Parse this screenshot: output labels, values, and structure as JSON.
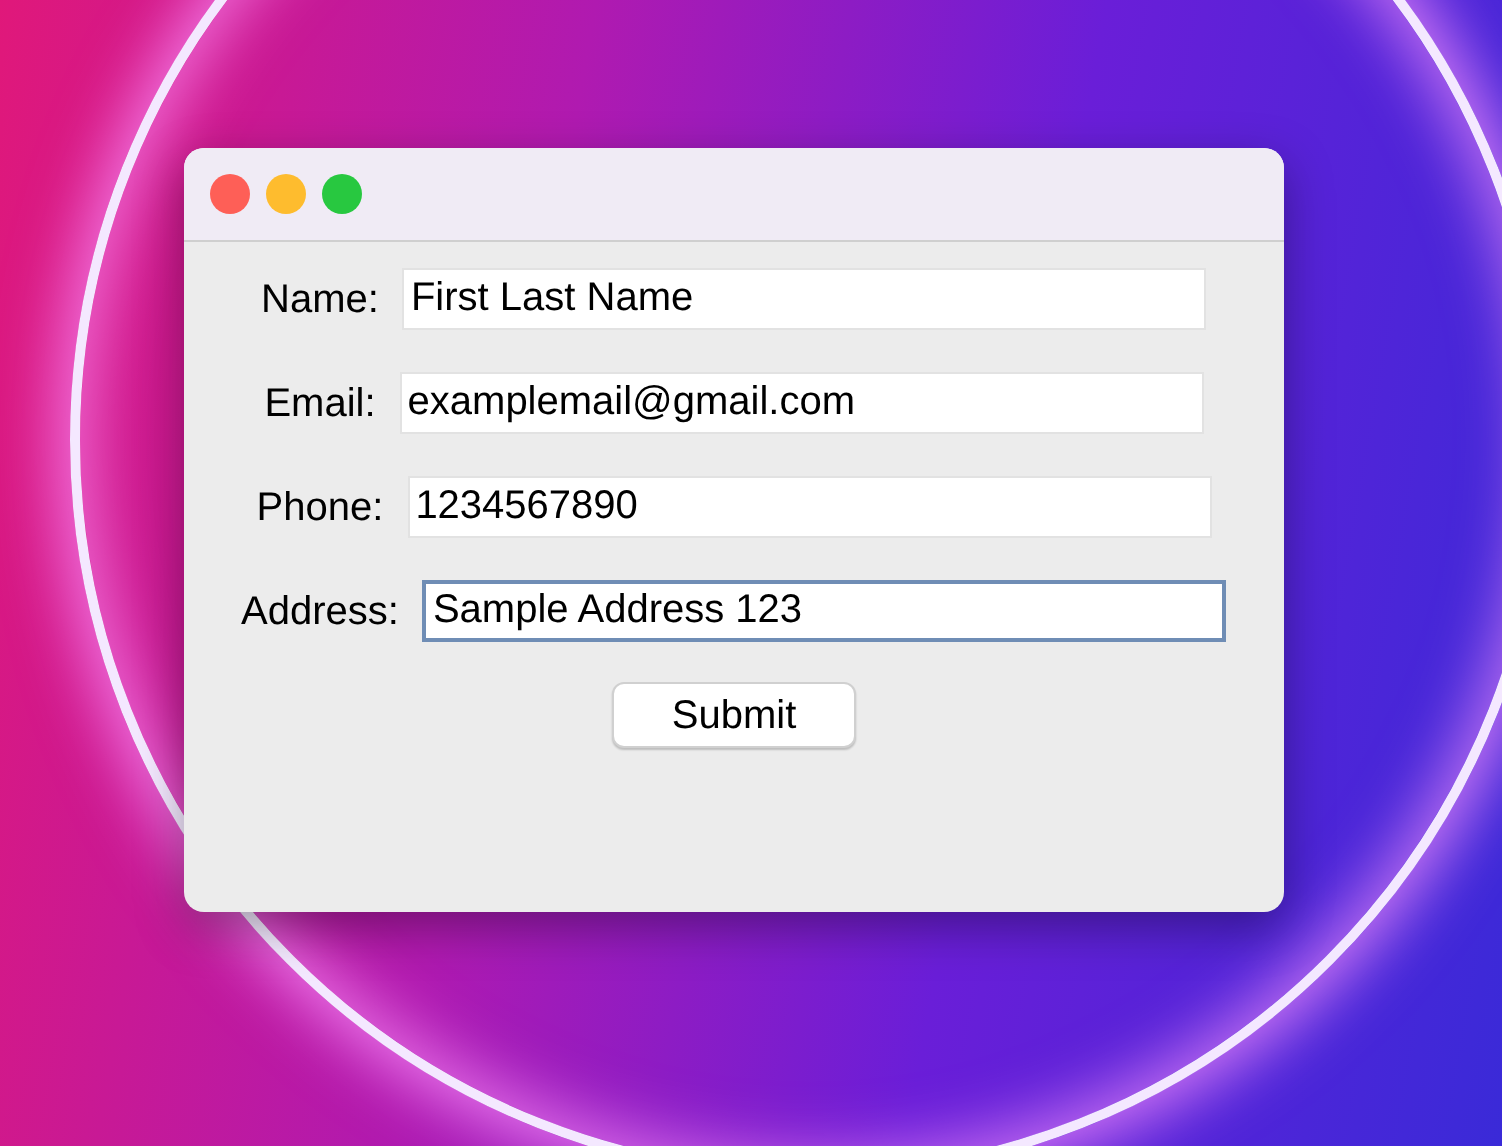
{
  "window": {
    "controls": [
      {
        "kind": "close"
      },
      {
        "kind": "minimize"
      },
      {
        "kind": "zoom"
      }
    ]
  },
  "form": {
    "fields": [
      {
        "label": "Name:",
        "value": "First Last Name",
        "focused": false
      },
      {
        "label": "Email:",
        "value": "examplemail@gmail.com",
        "focused": false
      },
      {
        "label": "Phone:",
        "value": "1234567890",
        "focused": false
      },
      {
        "label": "Address:",
        "value": "Sample Address 123",
        "focused": true
      }
    ],
    "submit": "Submit"
  }
}
